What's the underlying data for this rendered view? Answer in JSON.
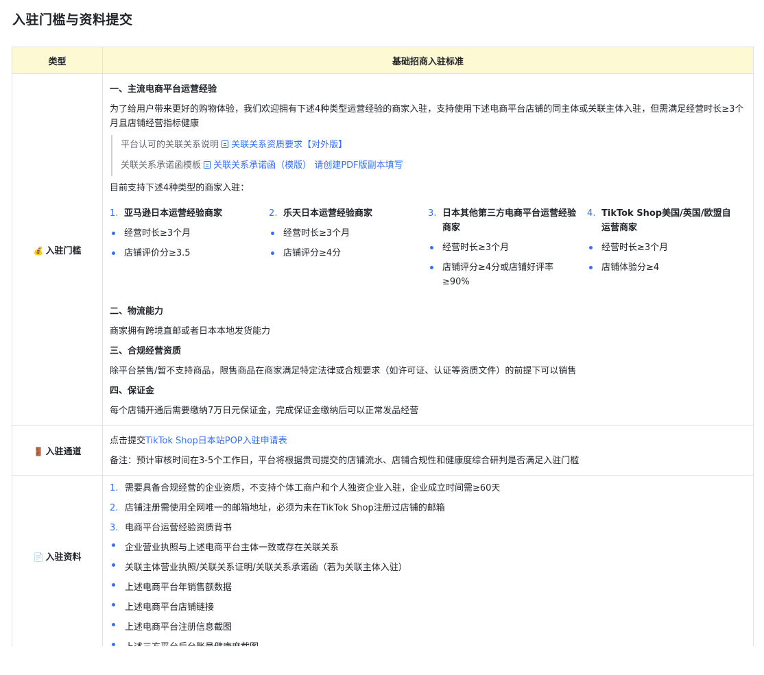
{
  "page": {
    "title": "入驻门槛与资料提交"
  },
  "table": {
    "header": {
      "type": "类型",
      "standard": "基础招商入驻标准"
    },
    "threshold": {
      "icon_name": "money-bag-icon",
      "icon_glyph": "💰",
      "label": "入驻门槛",
      "sec1_title": "一、主流电商平台运营经验",
      "sec1_desc": "为了给用户带来更好的购物体验，我们欢迎拥有下述4种类型运营经验的商家入驻，支持使用下述电商平台店铺的同主体或关联主体入驻，但需满足经营时长≥3个月且店铺经营指标健康",
      "quote1_prefix": "平台认可的关联关系说明",
      "quote1_link": "关联关系资质要求【对外版】",
      "quote2_prefix": "关联关系承诺函模板",
      "quote2_link": "关联关系承诺函（模版）",
      "quote2_suffix": "请创建PDF版副本填写",
      "support_intro": "目前支持下述4种类型的商家入驻：",
      "columns": [
        {
          "num": "1.",
          "title": "亚马逊日本运营经验商家",
          "bullets": [
            "经营时长≥3个月",
            "店铺评价分≥3.5"
          ]
        },
        {
          "num": "2.",
          "title": "乐天日本运营经验商家",
          "bullets": [
            "经营时长≥3个月",
            "店铺评分≥4分"
          ]
        },
        {
          "num": "3.",
          "title": "日本其他第三方电商平台运营经验商家",
          "bullets": [
            "经营时长≥3个月",
            "店铺评分≥4分或店铺好评率≥90%"
          ]
        },
        {
          "num": "4.",
          "title": "TikTok Shop美国/英国/欧盟自运营商家",
          "bullets": [
            "经营时长≥3个月",
            "店铺体验分≥4"
          ]
        }
      ],
      "sec2_title": "二、物流能力",
      "sec2_desc": "商家拥有跨境直邮或者日本本地发货能力",
      "sec3_title": "三、合规经营资质",
      "sec3_desc": "除平台禁售/暂不支持商品，限售商品在商家满足特定法律或合规要求（如许可证、认证等资质文件）的前提下可以销售",
      "sec4_title": "四、保证金",
      "sec4_desc": "每个店铺开通后需要缴纳7万日元保证金，完成保证金缴纳后可以正常发品经营"
    },
    "channel": {
      "icon_name": "door-icon",
      "icon_glyph": "🚪",
      "label": "入驻通道",
      "line1_prefix": "点击提交",
      "line1_link": "TikTok Shop日本站POP入驻申请表",
      "line2": "备注：预计审核时间在3-5个工作日，平台将根据贵司提交的店铺流水、店铺合规性和健康度综合研判是否满足入驻门槛"
    },
    "materials": {
      "icon_name": "document-icon",
      "icon_glyph": "📄",
      "label": "入驻资料",
      "ordered": [
        {
          "num": "1.",
          "text": "需要具备合规经营的企业资质，不支持个体工商户和个人独资企业入驻，企业成立时间需≥60天"
        },
        {
          "num": "2.",
          "text": "店铺注册需使用全网唯一的邮箱地址，必须为未在TikTok Shop注册过店铺的邮箱"
        },
        {
          "num": "3.",
          "text": "电商平台运营经验资质背书"
        }
      ],
      "bullets": [
        "企业营业执照与上述电商平台主体一致或存在关联关系",
        "关联主体营业执照/关联关系证明/关联关系承诺函（若为关联主体入驻）",
        "上述电商平台年销售额数据",
        "上述电商平台店铺链接",
        "上述电商平台注册信息截图",
        "上述三方平台后台账号健康度截图"
      ]
    }
  }
}
